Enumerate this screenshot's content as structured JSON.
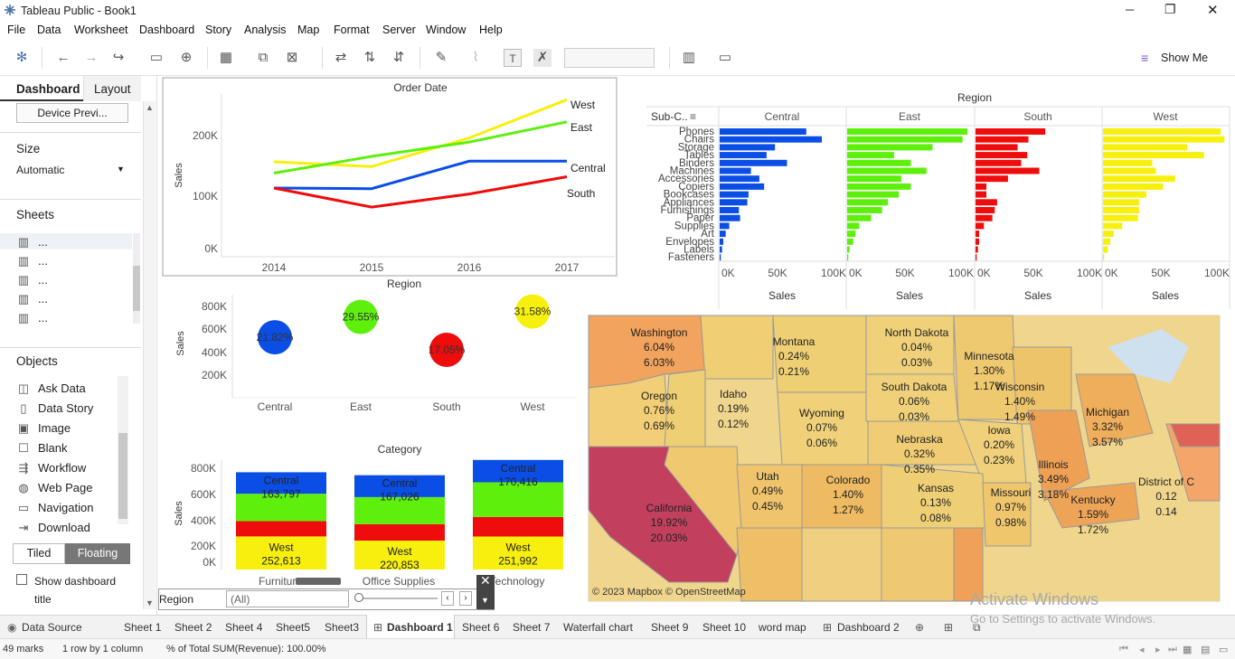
{
  "window": {
    "title": "Tableau Public - Book1",
    "min": "─",
    "max": "❐",
    "close": "✕"
  },
  "menu": [
    "File",
    "Data",
    "Worksheet",
    "Dashboard",
    "Story",
    "Analysis",
    "Map",
    "Format",
    "Server",
    "Window",
    "Help"
  ],
  "toolbar": {
    "show_me": "Show Me"
  },
  "left": {
    "tab_dashboard": "Dashboard",
    "tab_layout": "Layout",
    "device_preview": "Device Previ...",
    "size_label": "Size",
    "size_value": "Automatic",
    "sheets_label": "Sheets",
    "sheet_items": [
      "...",
      "...",
      "...",
      "...",
      "..."
    ],
    "objects_label": "Objects",
    "objects": [
      "Ask Data",
      "Data Story",
      "Image",
      "Blank",
      "Workflow",
      "Web Page",
      "Navigation",
      "Download"
    ],
    "tiled": "Tiled",
    "floating": "Floating",
    "show_title": "Show dashboard title"
  },
  "line_chart": {
    "title": "Order Date",
    "ylabel": "Sales",
    "yticks": [
      "200K",
      "100K",
      "0K"
    ],
    "xticks": [
      "2014",
      "2015",
      "2016",
      "2017"
    ],
    "labels": [
      "West",
      "East",
      "Central",
      "South"
    ]
  },
  "bubble_chart": {
    "title": "Region",
    "ylabel": "Sales",
    "yticks": [
      "800K",
      "600K",
      "400K",
      "200K"
    ],
    "xticks": [
      "Central",
      "East",
      "South",
      "West"
    ],
    "pct": [
      "21.82%",
      "29.55%",
      "17.05%",
      "31.58%"
    ]
  },
  "stack_chart": {
    "title": "Category",
    "ylabel": "Sales",
    "yticks": [
      "800K",
      "600K",
      "400K",
      "200K",
      "0K"
    ],
    "xticks": [
      "Furniture",
      "Office Supplies",
      "Technology"
    ],
    "central_label": "Central",
    "west_label": "West",
    "central_vals": [
      "163,797",
      "167,026",
      "170,416"
    ],
    "west_vals": [
      "252,613",
      "220,853",
      "251,992"
    ]
  },
  "subcat_chart": {
    "title": "Region",
    "sub_header": "Sub-C..",
    "regions": [
      "Central",
      "East",
      "South",
      "West"
    ],
    "subcats": [
      "Phones",
      "Chairs",
      "Storage",
      "Tables",
      "Binders",
      "Machines",
      "Accessories",
      "Copiers",
      "Bookcases",
      "Appliances",
      "Furnishings",
      "Paper",
      "Supplies",
      "Art",
      "Envelopes",
      "Labels",
      "Fasteners"
    ],
    "xticks": [
      "0K",
      "50K",
      "100K"
    ],
    "xlabel": "Sales"
  },
  "map": {
    "copyright": "© 2023 Mapbox © OpenStreetMap",
    "states": [
      {
        "name": "Washington",
        "a": "6.04%",
        "b": "6.03%"
      },
      {
        "name": "Montana",
        "a": "0.24%",
        "b": "0.21%"
      },
      {
        "name": "North Dakota",
        "a": "0.04%",
        "b": "0.03%"
      },
      {
        "name": "Minnesota",
        "a": "1.30%",
        "b": "1.17%"
      },
      {
        "name": "Oregon",
        "a": "0.76%",
        "b": "0.69%"
      },
      {
        "name": "Idaho",
        "a": "0.19%",
        "b": "0.12%"
      },
      {
        "name": "South Dakota",
        "a": "0.06%",
        "b": "0.03%"
      },
      {
        "name": "Wisconsin",
        "a": "1.40%",
        "b": "1.49%"
      },
      {
        "name": "Michigan",
        "a": "3.32%",
        "b": "3.57%"
      },
      {
        "name": "Wyoming",
        "a": "0.07%",
        "b": "0.06%"
      },
      {
        "name": "Iowa",
        "a": "0.20%",
        "b": "0.23%"
      },
      {
        "name": "Nebraska",
        "a": "0.32%",
        "b": "0.35%"
      },
      {
        "name": "Illinois",
        "a": "3.49%",
        "b": "3.18%"
      },
      {
        "name": "Utah",
        "a": "0.49%",
        "b": "0.45%"
      },
      {
        "name": "Colorado",
        "a": "1.40%",
        "b": "1.27%"
      },
      {
        "name": "Kansas",
        "a": "0.13%",
        "b": "0.08%"
      },
      {
        "name": "Missouri",
        "a": "0.97%",
        "b": "0.98%"
      },
      {
        "name": "Kentucky",
        "a": "1.59%",
        "b": "1.72%"
      },
      {
        "name": "District of C",
        "a": "0.12",
        "b": "0.14"
      },
      {
        "name": "California",
        "a": "19.92%",
        "b": "20.03%"
      }
    ]
  },
  "filter": {
    "label": "Region",
    "value": "(All)"
  },
  "tabs": [
    "Data Source",
    "Sheet 1",
    "Sheet 2",
    "Sheet 4",
    "Sheet5",
    "Sheet3",
    "Dashboard 1",
    "Sheet 6",
    "Sheet 7",
    "Waterfall chart",
    "Sheet 9",
    "Sheet 10",
    "word map",
    "Dashboard 2"
  ],
  "status": {
    "marks": "49 marks",
    "rows": "1 row by 1 column",
    "sum": "% of Total SUM(Revenue): 100.00%"
  },
  "watermark": {
    "line1": "Activate Windows",
    "line2": "Go to Settings to activate Windows."
  },
  "colors": {
    "central": "#0a4ee6",
    "east": "#5ef00c",
    "south": "#ee0c0c",
    "west": "#f7f00e"
  },
  "chart_data": [
    {
      "type": "line",
      "title": "Order Date",
      "ylabel": "Sales",
      "x": [
        2014,
        2015,
        2016,
        2017
      ],
      "ylim": [
        0,
        250000
      ],
      "series": [
        {
          "name": "West",
          "values": [
            147000,
            139000,
            187000,
            251000
          ]
        },
        {
          "name": "East",
          "values": [
            128000,
            156000,
            180000,
            214000
          ]
        },
        {
          "name": "Central",
          "values": [
            103000,
            102000,
            148000,
            148000
          ]
        },
        {
          "name": "South",
          "values": [
            103000,
            71000,
            93000,
            122000
          ]
        }
      ]
    },
    {
      "type": "scatter",
      "title": "Region",
      "ylabel": "Sales",
      "categories": [
        "Central",
        "East",
        "South",
        "West"
      ],
      "values": [
        501000,
        678000,
        392000,
        725000
      ],
      "labels": [
        "21.82%",
        "29.55%",
        "17.05%",
        "31.58%"
      ]
    },
    {
      "type": "bar",
      "title": "Category",
      "ylabel": "Sales",
      "categories": [
        "Furniture",
        "Office Supplies",
        "Technology"
      ],
      "ylim": [
        0,
        800000
      ],
      "series": [
        {
          "name": "West",
          "values": [
            252613,
            220853,
            251992
          ]
        },
        {
          "name": "South",
          "values": [
            117298,
            125651,
            148771
          ]
        },
        {
          "name": "East",
          "values": [
            208291,
            205516,
            264974
          ]
        },
        {
          "name": "Central",
          "values": [
            163797,
            167026,
            170416
          ]
        }
      ]
    },
    {
      "type": "bar",
      "title": "Region",
      "ylabel": "Sub-Category",
      "xlabel": "Sales",
      "xlim": [
        0,
        100000
      ],
      "categories": [
        "Phones",
        "Chairs",
        "Storage",
        "Tables",
        "Binders",
        "Machines",
        "Accessories",
        "Copiers",
        "Bookcases",
        "Appliances",
        "Furnishings",
        "Paper",
        "Supplies",
        "Art",
        "Envelopes",
        "Labels",
        "Fasteners"
      ],
      "series": [
        {
          "name": "Central",
          "values": [
            72000,
            85000,
            46000,
            39000,
            56000,
            26000,
            33000,
            37000,
            24000,
            23000,
            16000,
            17000,
            8000,
            5000,
            3000,
            2000,
            1000
          ]
        },
        {
          "name": "East",
          "values": [
            100000,
            96000,
            71000,
            39000,
            53000,
            66000,
            45000,
            53000,
            43000,
            34000,
            29000,
            20000,
            10000,
            7000,
            5000,
            2000,
            1000
          ]
        },
        {
          "name": "South",
          "values": [
            58000,
            44000,
            35000,
            43000,
            38000,
            53000,
            27000,
            9000,
            9000,
            18000,
            16000,
            14000,
            7000,
            3000,
            3000,
            2000,
            1000
          ]
        },
        {
          "name": "West",
          "values": [
            98000,
            101000,
            70000,
            84000,
            41000,
            44000,
            60000,
            50000,
            36000,
            30000,
            30000,
            29000,
            16000,
            9000,
            6000,
            4000,
            1000
          ]
        }
      ]
    }
  ]
}
